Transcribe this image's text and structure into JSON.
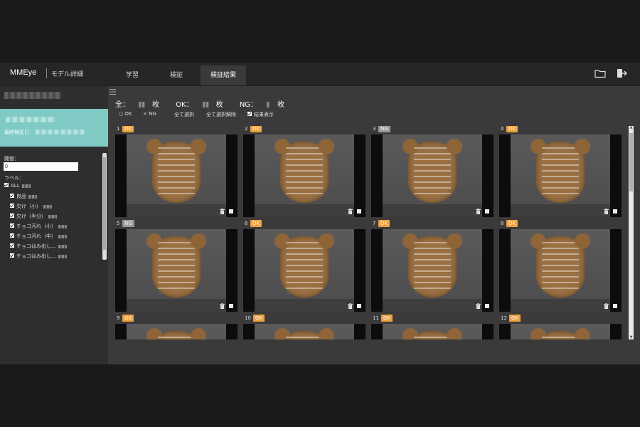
{
  "header": {
    "brand": "MMEye",
    "model_detail": "モデル詳細",
    "tabs": [
      {
        "label": "学習",
        "active": false
      },
      {
        "label": "検証",
        "active": false
      },
      {
        "label": "検証結果",
        "active": true
      }
    ],
    "icons": [
      "folder-icon",
      "logout-icon"
    ]
  },
  "sidebar": {
    "last_verified_label": "最終検証日：",
    "threshold_label": "閾値：",
    "threshold_value": "0",
    "labels_title": "ラベル：",
    "labels": [
      {
        "label": "ALL",
        "checked": true
      },
      {
        "label": "良品",
        "checked": true
      },
      {
        "label": "欠け（小）",
        "checked": true
      },
      {
        "label": "欠け（半分）",
        "checked": true
      },
      {
        "label": "チョコ汚れ（小）",
        "checked": true
      },
      {
        "label": "チョコ汚れ（中）",
        "checked": true
      },
      {
        "label": "チョコはみ出し…",
        "checked": true
      },
      {
        "label": "チョコはみ出し…",
        "checked": true
      }
    ]
  },
  "main": {
    "counts": {
      "all": "全：",
      "all_unit": "枚",
      "ok": "OK：",
      "ok_unit": "枚",
      "ng": "NG：",
      "ng_unit": "枚"
    },
    "controls": {
      "ok_filter": "OK",
      "ng_filter": "NG",
      "select_all": "全て選択",
      "deselect_all": "全て選択解除",
      "show_results": "結果表示"
    },
    "cards": [
      {
        "num": "1",
        "status": "OK"
      },
      {
        "num": "2",
        "status": "OK"
      },
      {
        "num": "3",
        "status": "NG"
      },
      {
        "num": "4",
        "status": "OK"
      },
      {
        "num": "5",
        "status": "NG"
      },
      {
        "num": "6",
        "status": "OK"
      },
      {
        "num": "7",
        "status": "OK"
      },
      {
        "num": "8",
        "status": "OK"
      },
      {
        "num": "9",
        "status": "OK"
      },
      {
        "num": "10",
        "status": "OK"
      },
      {
        "num": "11",
        "status": "OK"
      },
      {
        "num": "12",
        "status": "OK"
      }
    ]
  },
  "colors": {
    "accent_teal": "#7fcac4",
    "ok_badge": "#f0a040",
    "ng_badge": "#999999",
    "panel": "#3a3a3a"
  }
}
